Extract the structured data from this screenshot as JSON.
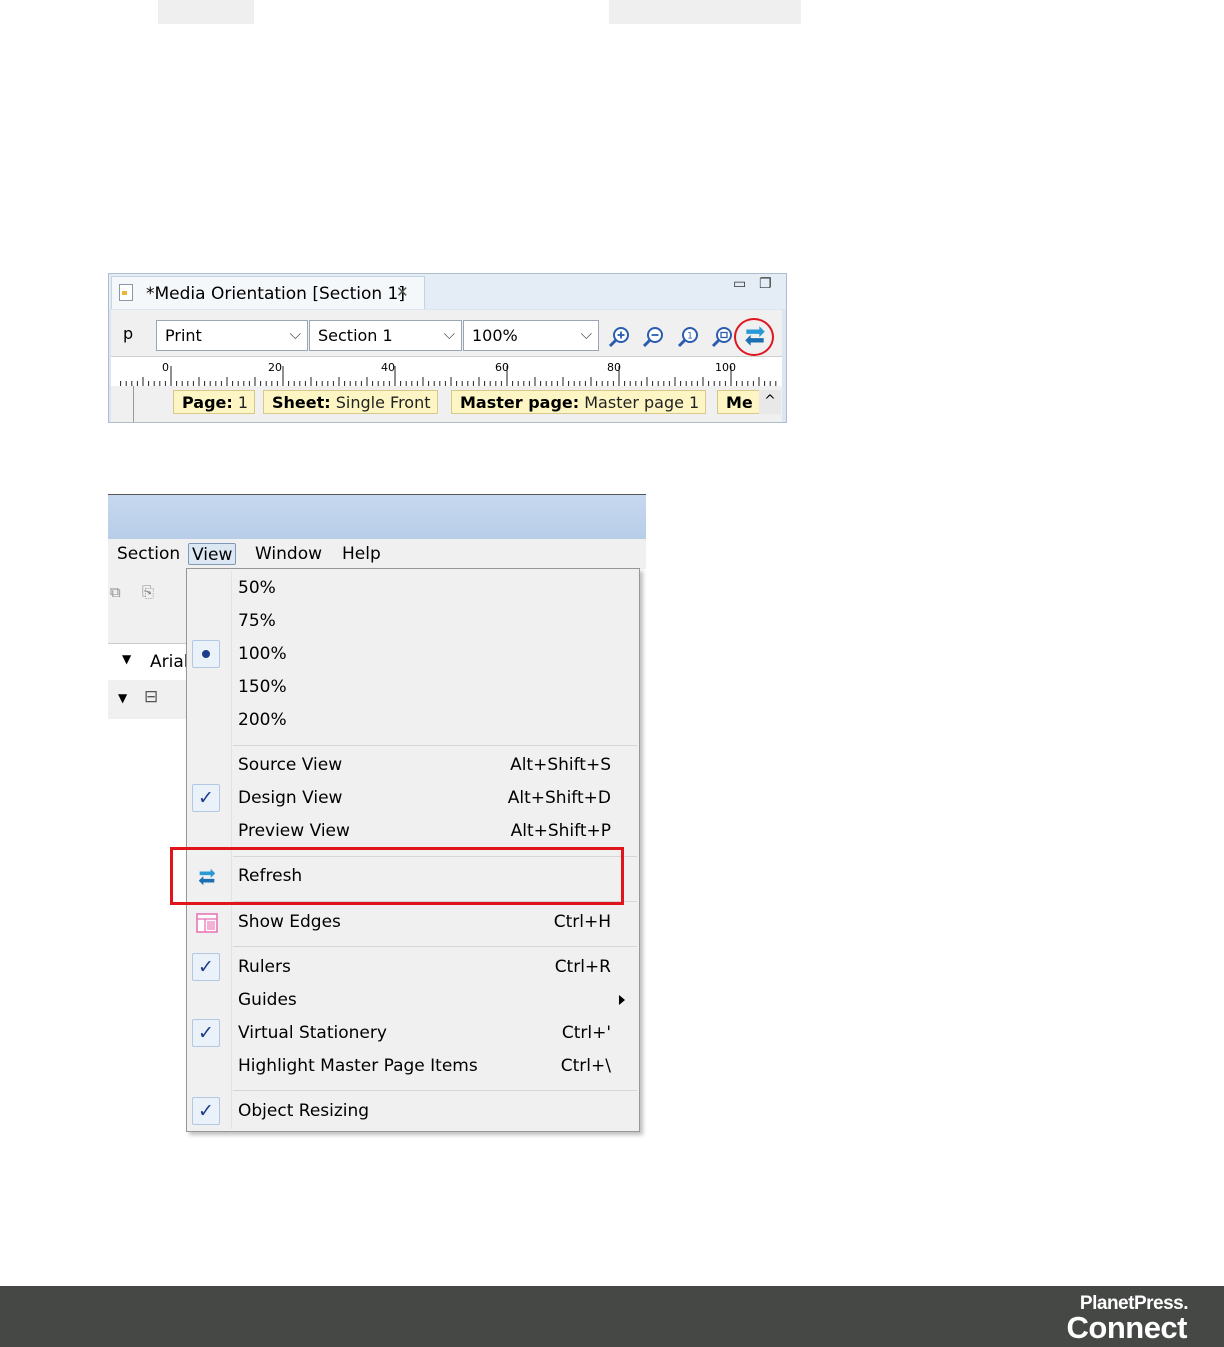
{
  "editor": {
    "tab_title": "*Media Orientation [Section 1]",
    "toolbar_label": "p",
    "output_combo": "Print",
    "section_combo": "Section 1",
    "zoom_combo": "100%",
    "ruler_ticks": [
      "0",
      "20",
      "40",
      "60",
      "80",
      "100"
    ],
    "status": {
      "page_label": "Page:",
      "page_value": "1",
      "sheet_label": "Sheet:",
      "sheet_value": "Single Front",
      "master_label": "Master page:",
      "master_value": "Master page 1",
      "media_label": "Me"
    }
  },
  "app": {
    "menubar": [
      "Section",
      "View",
      "Window",
      "Help"
    ],
    "font_combo": "Arial"
  },
  "view_menu": {
    "zoom_items": [
      "50%",
      "75%",
      "100%",
      "150%",
      "200%"
    ],
    "selected_zoom": "100%",
    "items": [
      {
        "label": "Source View",
        "accel": "Alt+Shift+S",
        "checked": false
      },
      {
        "label": "Design View",
        "accel": "Alt+Shift+D",
        "checked": true
      },
      {
        "label": "Preview View",
        "accel": "Alt+Shift+P",
        "checked": false
      },
      {
        "label": "Refresh",
        "accel": "",
        "icon": "refresh-icon",
        "highlighted": true
      },
      {
        "label": "Show Edges",
        "accel": "Ctrl+H",
        "icon": "show-edges-icon"
      },
      {
        "label": "Rulers",
        "accel": "Ctrl+R",
        "checked": true
      },
      {
        "label": "Guides",
        "accel": "",
        "submenu": true
      },
      {
        "label": "Virtual Stationery",
        "accel": "Ctrl+'",
        "checked": true
      },
      {
        "label": "Highlight Master Page Items",
        "accel": "Ctrl+\\",
        "checked": false
      },
      {
        "label": "Object Resizing",
        "accel": "",
        "checked": true
      }
    ],
    "highlight_color": "#e0141d",
    "check_color": "#1d3c8c"
  },
  "footer": {
    "brand_line1": "PlanetPress.",
    "brand_line2": "Connect",
    "background": "#464846"
  }
}
